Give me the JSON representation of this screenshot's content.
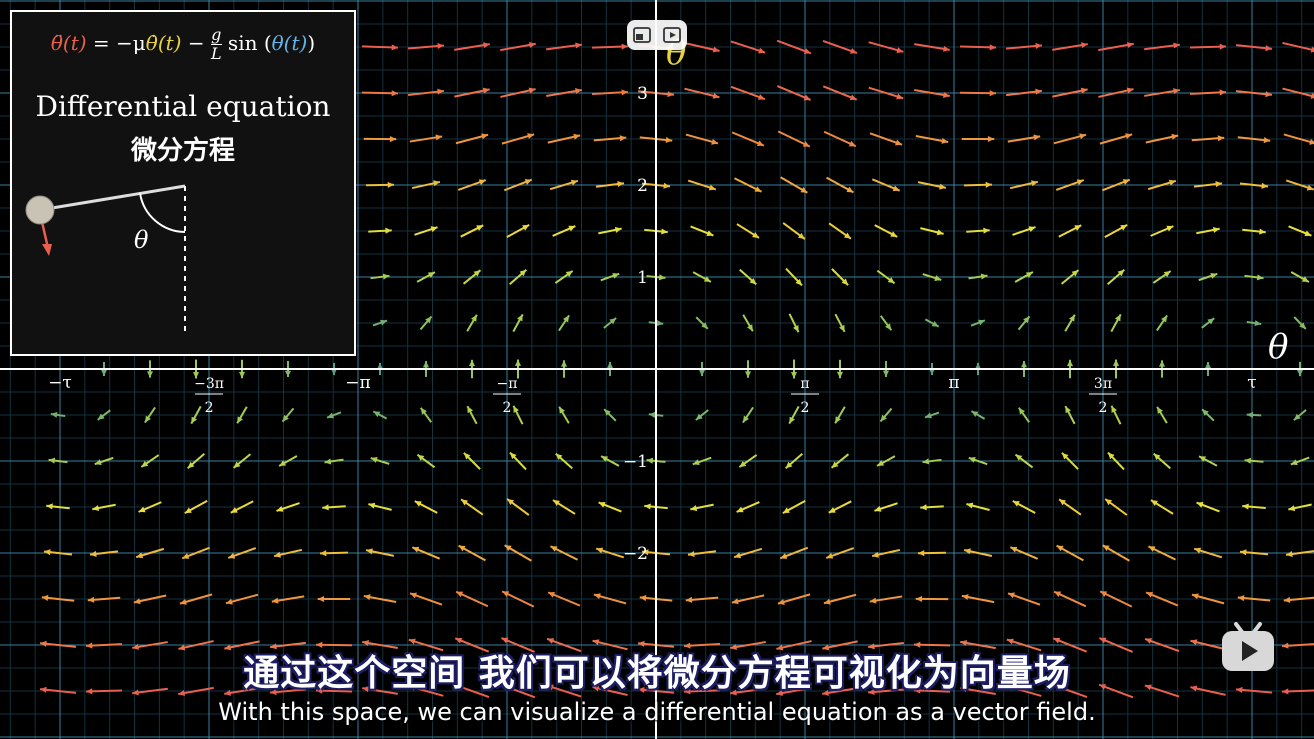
{
  "colors": {
    "background": "#000000",
    "grid_major": "#3a7fa0",
    "grid_minor": "#14323f",
    "axis": "#ffffff",
    "equation_theta": "#e8604d",
    "equation_dtheta": "#e8d240",
    "equation_sin_theta": "#5fb4e8"
  },
  "inset": {
    "equation_lhs": "θ̈(t)",
    "equation_mid": " = −μ",
    "equation_dtheta": "θ̇(t)",
    "equation_minus": " − ",
    "equation_frac_num": "g",
    "equation_frac_den": "L",
    "equation_sin": " sin (",
    "equation_theta": "θ(t)",
    "equation_close": ")",
    "title_en": "Differential equation",
    "title_zh": "微分方程",
    "angle_label": "θ"
  },
  "axes": {
    "x_name": "θ",
    "y_name": "θ̇",
    "x_ticks": [
      {
        "label": "−τ",
        "value": -6.283
      },
      {
        "num": "−3π",
        "den": "2",
        "value": -4.712
      },
      {
        "label": "−π",
        "value": -3.1416
      },
      {
        "num": "−π",
        "den": "2",
        "value": -1.5708
      },
      {
        "num": "π",
        "den": "2",
        "value": 1.5708
      },
      {
        "label": "π",
        "value": 3.1416
      },
      {
        "num": "3π",
        "den": "2",
        "value": 4.712
      },
      {
        "label": "τ",
        "value": 6.283
      }
    ],
    "y_ticks": [
      {
        "label": "3",
        "value": 3
      },
      {
        "label": "2",
        "value": 2
      },
      {
        "label": "1",
        "value": 1
      },
      {
        "label": "−1",
        "value": -1
      },
      {
        "label": "−2",
        "value": -2
      }
    ]
  },
  "vector_field": {
    "mu": 0.1,
    "g_over_L": 1.0
  },
  "controls": {
    "pip_icon": "picture-in-picture-icon",
    "video_icon": "video-icon"
  },
  "subtitles": {
    "zh": "通过这个空间  我们可以将微分方程可视化为向量场",
    "en": "With this space, we can visualize a differential equation as a vector field."
  },
  "logo": "bilibili-tv-icon"
}
